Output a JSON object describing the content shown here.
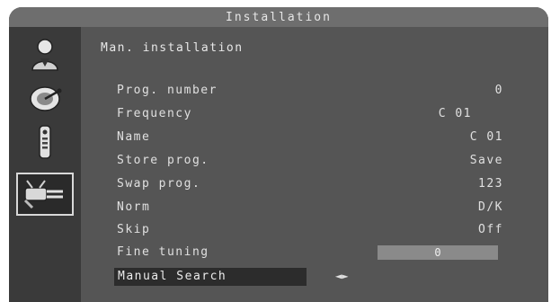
{
  "window": {
    "title": "Installation"
  },
  "sidebar": {
    "items": [
      {
        "icon": "person-icon"
      },
      {
        "icon": "satellite-dish-icon"
      },
      {
        "icon": "remote-control-icon"
      },
      {
        "icon": "antenna-plug-icon",
        "selected": true
      }
    ]
  },
  "menu": {
    "heading": "Man. installation",
    "rows": [
      {
        "label": "Prog. number",
        "value": "0"
      },
      {
        "label": "Frequency",
        "value": "C 01"
      },
      {
        "label": "Name",
        "value": "C 01"
      },
      {
        "label": "Store prog.",
        "value": "Save"
      },
      {
        "label": "Swap prog.",
        "value": "123"
      },
      {
        "label": "Norm",
        "value": "D/K"
      },
      {
        "label": "Skip",
        "value": "Off"
      }
    ],
    "fine_tuning": {
      "label": "Fine tuning",
      "value": "0"
    },
    "manual_search": {
      "label": "Manual Search",
      "arrows": "◄►"
    }
  }
}
